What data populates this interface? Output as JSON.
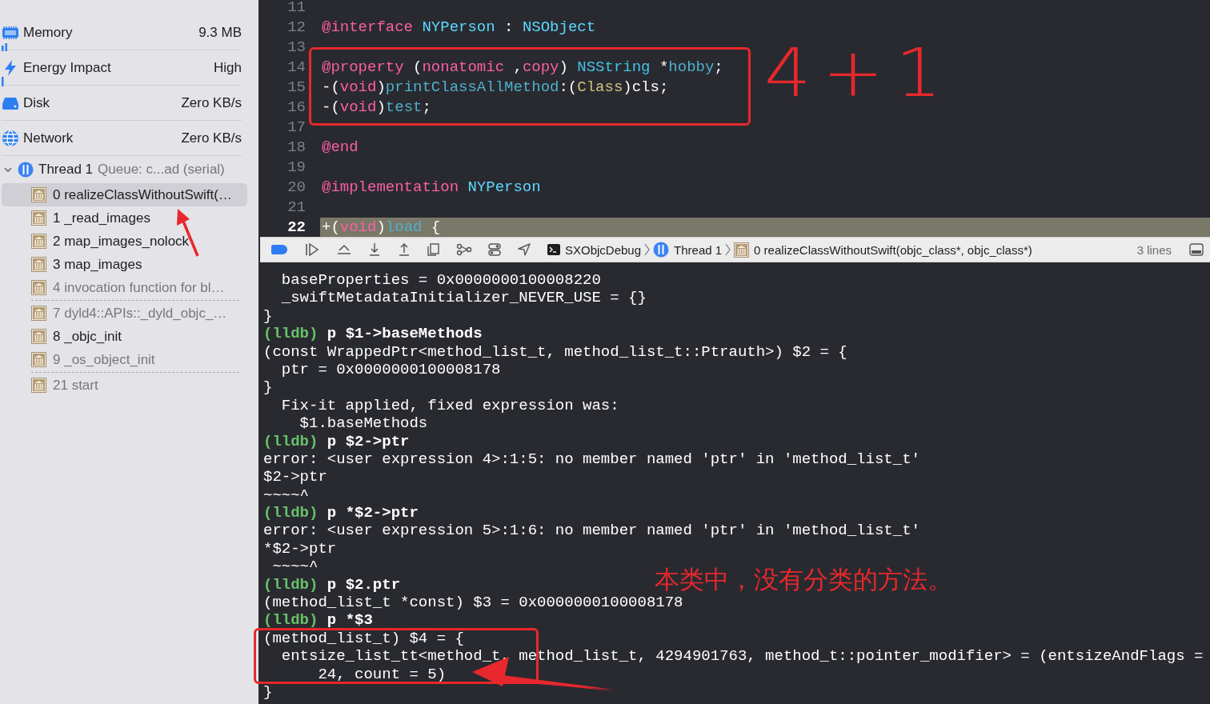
{
  "sidebar": {
    "gauges": [
      {
        "kind": "memory",
        "label": "Memory",
        "value": "9.3 MB"
      },
      {
        "kind": "energy",
        "label": "Energy Impact",
        "value": "High"
      },
      {
        "kind": "disk",
        "label": "Disk",
        "value": "Zero KB/s"
      },
      {
        "kind": "network",
        "label": "Network",
        "value": "Zero KB/s"
      }
    ],
    "thread": {
      "name": "Thread 1",
      "queue": "Queue: c...ad (serial)",
      "expanded": true
    },
    "frames": [
      {
        "label": "0 realizeClassWithoutSwift(…",
        "selected": true,
        "dimmed": false,
        "separator_after": false
      },
      {
        "label": "1 _read_images",
        "selected": false,
        "dimmed": false,
        "separator_after": false
      },
      {
        "label": "2 map_images_nolock",
        "selected": false,
        "dimmed": false,
        "separator_after": false
      },
      {
        "label": "3 map_images",
        "selected": false,
        "dimmed": false,
        "separator_after": false
      },
      {
        "label": "4 invocation function for bl…",
        "selected": false,
        "dimmed": true,
        "separator_after": true
      },
      {
        "label": "7 dyld4::APIs::_dyld_objc_…",
        "selected": false,
        "dimmed": true,
        "separator_after": false
      },
      {
        "label": "8 _objc_init",
        "selected": false,
        "dimmed": false,
        "separator_after": false
      },
      {
        "label": "9 _os_object_init",
        "selected": false,
        "dimmed": true,
        "separator_after": true
      },
      {
        "label": "21 start",
        "selected": false,
        "dimmed": true,
        "separator_after": false
      }
    ]
  },
  "editor": {
    "lines": [
      {
        "number": "11",
        "current": false
      },
      {
        "number": "12",
        "current": false,
        "tokens": [
          {
            "kind": "keyword",
            "text": "@interface"
          },
          {
            "kind": "type",
            "text": " NYPerson"
          },
          {
            "kind": "plain",
            "text": " : "
          },
          {
            "kind": "type",
            "text": "NSObject"
          }
        ]
      },
      {
        "number": "13",
        "current": false
      },
      {
        "number": "14",
        "current": false,
        "tokens": [
          {
            "kind": "keyword",
            "text": "@property"
          },
          {
            "kind": "plain",
            "text": " ("
          },
          {
            "kind": "keyword",
            "text": "nonatomic"
          },
          {
            "kind": "plain",
            "text": " ,"
          },
          {
            "kind": "keyword",
            "text": "copy"
          },
          {
            "kind": "plain",
            "text": ") "
          },
          {
            "kind": "type2",
            "text": "NSString"
          },
          {
            "kind": "plain",
            "text": " *"
          },
          {
            "kind": "method",
            "text": "hobby"
          },
          {
            "kind": "plain",
            "text": ";"
          }
        ]
      },
      {
        "number": "15",
        "current": false,
        "tokens": [
          {
            "kind": "plain",
            "text": "-("
          },
          {
            "kind": "keyword",
            "text": "void"
          },
          {
            "kind": "plain",
            "text": ")"
          },
          {
            "kind": "method",
            "text": "printClassAllMethod"
          },
          {
            "kind": "plain",
            "text": ":("
          },
          {
            "kind": "class",
            "text": "Class"
          },
          {
            "kind": "plain",
            "text": ")cls;"
          }
        ]
      },
      {
        "number": "16",
        "current": false,
        "tokens": [
          {
            "kind": "plain",
            "text": "-("
          },
          {
            "kind": "keyword",
            "text": "void"
          },
          {
            "kind": "plain",
            "text": ")"
          },
          {
            "kind": "method",
            "text": "test"
          },
          {
            "kind": "plain",
            "text": ";"
          }
        ]
      },
      {
        "number": "17",
        "current": false
      },
      {
        "number": "18",
        "current": false,
        "tokens": [
          {
            "kind": "keyword",
            "text": "@end"
          }
        ]
      },
      {
        "number": "19",
        "current": false
      },
      {
        "number": "20",
        "current": false,
        "tokens": [
          {
            "kind": "keyword",
            "text": "@implementation"
          },
          {
            "kind": "type",
            "text": " NYPerson"
          }
        ]
      },
      {
        "number": "21",
        "current": false
      },
      {
        "number": "22",
        "current": true,
        "tokens": [
          {
            "kind": "plain",
            "text": "+("
          },
          {
            "kind": "keyword",
            "text": "void"
          },
          {
            "kind": "plain",
            "text": ")"
          },
          {
            "kind": "method",
            "text": "load"
          },
          {
            "kind": "plain",
            "text": " {"
          }
        ]
      }
    ]
  },
  "debug_bar": {
    "breakpoints_active": true,
    "breadcrumbs": [
      {
        "kind": "target",
        "label": "SXObjcDebug"
      },
      {
        "kind": "thread",
        "label": "Thread 1"
      },
      {
        "kind": "frame",
        "label": "0 realizeClassWithoutSwift(objc_class*, objc_class*)"
      }
    ],
    "filter": "3 lines"
  },
  "console": {
    "lines": [
      {
        "kind": "output",
        "text": "  baseProperties = 0x0000000100008220"
      },
      {
        "kind": "output",
        "text": "  _swiftMetadataInitializer_NEVER_USE = {}"
      },
      {
        "kind": "output",
        "text": "}"
      },
      {
        "kind": "prompt",
        "prompt": "(lldb)",
        "command": "p $1->baseMethods"
      },
      {
        "kind": "output",
        "text": "(const WrappedPtr<method_list_t, method_list_t::Ptrauth>) $2 = {"
      },
      {
        "kind": "output",
        "text": "  ptr = 0x0000000100008178"
      },
      {
        "kind": "output",
        "text": "}"
      },
      {
        "kind": "output",
        "text": "  Fix-it applied, fixed expression was:"
      },
      {
        "kind": "output",
        "text": "    $1.baseMethods"
      },
      {
        "kind": "prompt",
        "prompt": "(lldb)",
        "command": "p $2->ptr"
      },
      {
        "kind": "output",
        "text": "error: <user expression 4>:1:5: no member named 'ptr' in 'method_list_t'"
      },
      {
        "kind": "output",
        "text": "$2->ptr"
      },
      {
        "kind": "output",
        "text": "~~~~^"
      },
      {
        "kind": "prompt",
        "prompt": "(lldb)",
        "command": "p *$2->ptr"
      },
      {
        "kind": "output",
        "text": "error: <user expression 5>:1:6: no member named 'ptr' in 'method_list_t'"
      },
      {
        "kind": "output",
        "text": "*$2->ptr"
      },
      {
        "kind": "output",
        "text": " ~~~~^"
      },
      {
        "kind": "prompt",
        "prompt": "(lldb)",
        "command": "p $2.ptr"
      },
      {
        "kind": "output",
        "text": "(method_list_t *const) $3 = 0x0000000100008178"
      },
      {
        "kind": "prompt",
        "prompt": "(lldb)",
        "command": "p *$3"
      },
      {
        "kind": "output",
        "text": "(method_list_t) $4 = {"
      },
      {
        "kind": "output",
        "text": "  entsize_list_tt<method_t, method_list_t, 4294901763, method_t::pointer_modifier> = (entsizeAndFlags ="
      },
      {
        "kind": "output",
        "text": "      24, count = 5)"
      },
      {
        "kind": "output",
        "text": "}"
      }
    ]
  },
  "annotations": {
    "note": "4+1",
    "comment": "本类中，没有分类的方法。"
  }
}
